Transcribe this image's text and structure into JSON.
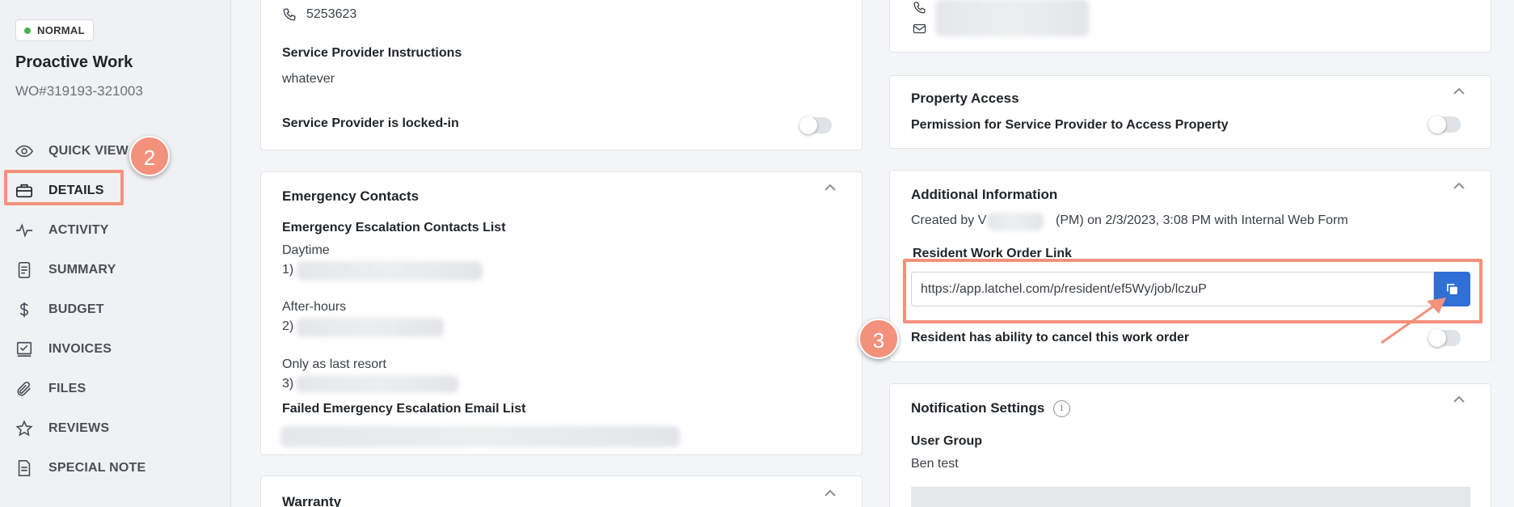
{
  "sidebar": {
    "status_badge": "NORMAL",
    "title": "Proactive Work",
    "wo_number": "WO#319193-321003",
    "nav": [
      {
        "label": "QUICK VIEW",
        "icon": "eye-icon"
      },
      {
        "label": "DETAILS",
        "icon": "briefcase-icon"
      },
      {
        "label": "ACTIVITY",
        "icon": "activity-icon"
      },
      {
        "label": "SUMMARY",
        "icon": "document-icon"
      },
      {
        "label": "BUDGET",
        "icon": "dollar-icon"
      },
      {
        "label": "INVOICES",
        "icon": "invoice-icon"
      },
      {
        "label": "FILES",
        "icon": "paperclip-icon"
      },
      {
        "label": "REVIEWS",
        "icon": "star-icon"
      },
      {
        "label": "SPECIAL NOTE",
        "icon": "note-icon"
      }
    ]
  },
  "annotations": {
    "step2": "2",
    "step3": "3"
  },
  "provider_card": {
    "phone": "5253623",
    "instructions_label": "Service Provider Instructions",
    "instructions_value": "whatever",
    "locked_label": "Service Provider is locked-in"
  },
  "emergency": {
    "title": "Emergency Contacts",
    "list_label": "Emergency Escalation Contacts List",
    "daytime": "Daytime",
    "daytime_idx": "1)",
    "after_hours": "After-hours",
    "after_idx": "2)",
    "last_resort": "Only as last resort",
    "last_idx": "3)",
    "failed_label": "Failed Emergency Escalation Email List"
  },
  "warranty": {
    "title": "Warranty"
  },
  "property_access": {
    "title": "Property Access",
    "permission_label": "Permission for Service Provider to Access Property"
  },
  "additional": {
    "title": "Additional Information",
    "created_prefix": "Created by V",
    "created_suffix": "(PM) on 2/3/2023, 3:08 PM with Internal Web Form",
    "link_label": "Resident Work Order Link",
    "link_url": "https://app.latchel.com/p/resident/ef5Wy/job/lczuP",
    "cancel_label": "Resident has ability to cancel this work order"
  },
  "notifications": {
    "title": "Notification Settings",
    "user_group_label": "User Group",
    "user_group_value": "Ben test"
  },
  "colors": {
    "accent": "#2f6fd6",
    "highlight": "#f4917d",
    "status_green": "#4caf50"
  }
}
